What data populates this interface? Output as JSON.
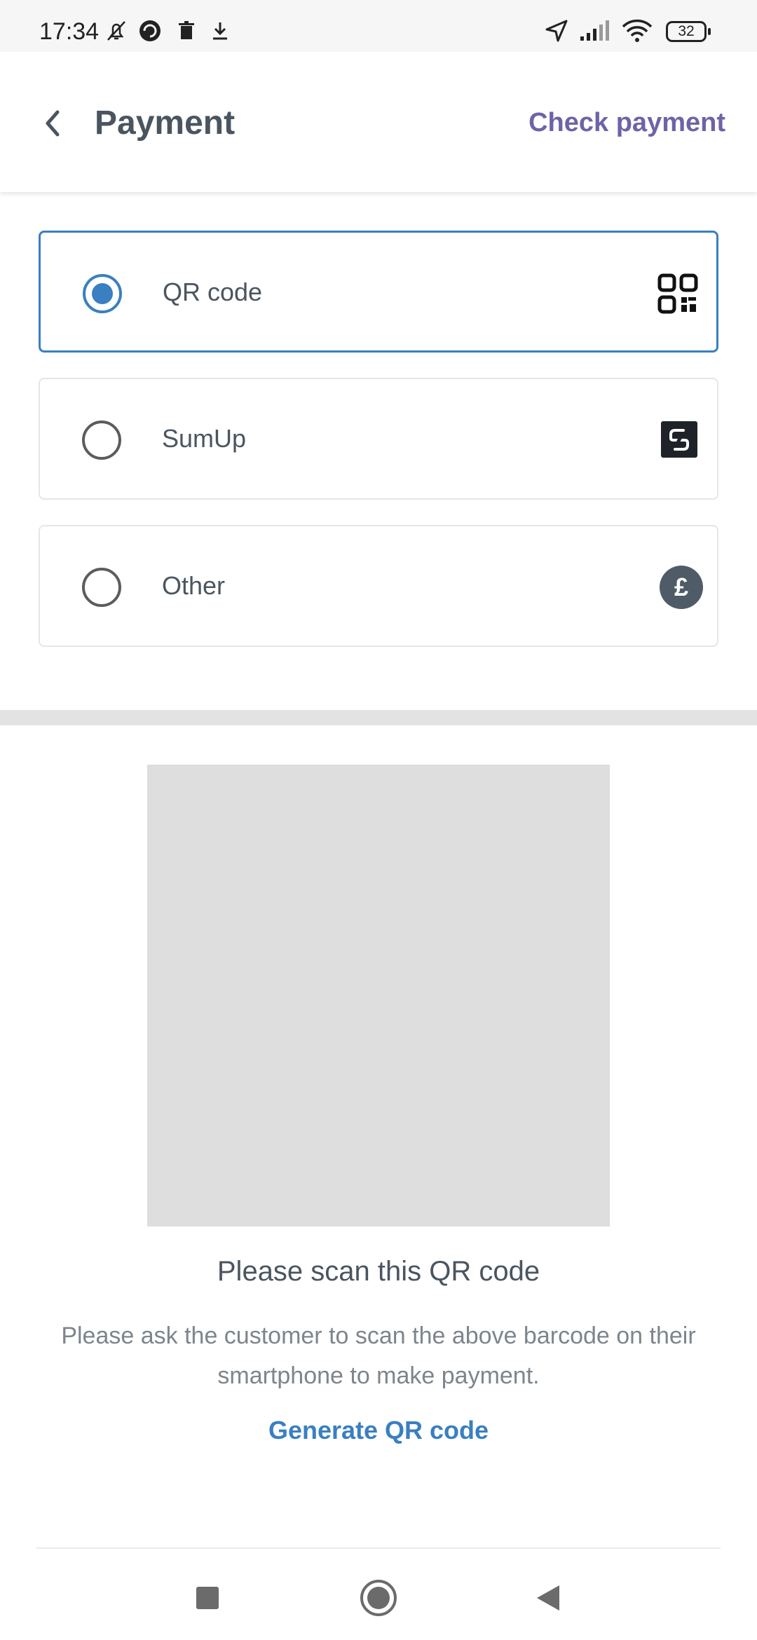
{
  "status_bar": {
    "time": "17:34",
    "battery": "32",
    "icons": [
      "bell-off-icon",
      "circle-arrow-icon",
      "trash-icon",
      "download-icon",
      "location-arrow-icon",
      "signal-icon",
      "wifi-icon",
      "battery-icon"
    ]
  },
  "header": {
    "back_icon": "chevron-left-icon",
    "title": "Payment",
    "action": "Check payment"
  },
  "payment_options": [
    {
      "label": "QR code",
      "icon": "qr-code-icon",
      "selected": true
    },
    {
      "label": "SumUp",
      "icon": "sumup-logo-icon",
      "selected": false
    },
    {
      "label": "Other",
      "icon": "pound-icon",
      "icon_text": "£",
      "selected": false
    }
  ],
  "qr": {
    "heading": "Please scan this QR code",
    "description": "Please ask the customer to scan the above barcode on their smartphone to make payment.",
    "generate_label": "Generate QR code"
  },
  "nav": [
    "recents-square-icon",
    "home-circle-icon",
    "back-triangle-icon"
  ],
  "colors": {
    "accent_blue": "#3a7fc1",
    "accent_purple": "#6e63a7",
    "text_dark": "#4a5560",
    "text_muted": "#7d858c"
  }
}
